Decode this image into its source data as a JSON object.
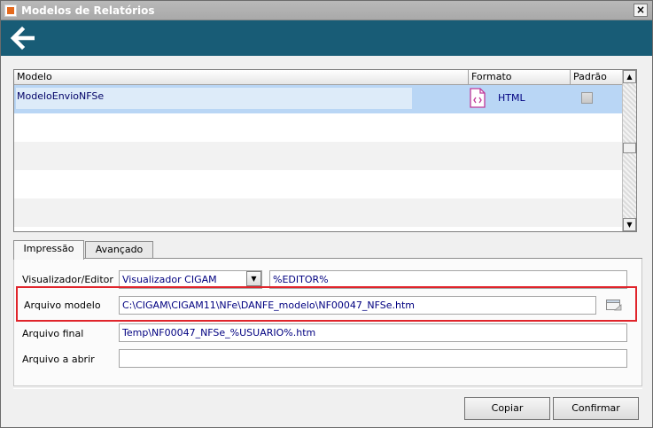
{
  "window": {
    "title": "Modelos de Relatórios",
    "close_glyph": "×",
    "icon": "app-icon"
  },
  "toolbar": {
    "back_icon": "back-arrow-icon"
  },
  "grid": {
    "columns": [
      "Modelo",
      "Formato",
      "Padrão"
    ],
    "rows": [
      {
        "modelo": "ModeloEnvioNFSe",
        "formato": "HTML",
        "padrao": false,
        "format_icon": "html-file-icon"
      }
    ]
  },
  "tabs": [
    {
      "label": "Impressão",
      "active": true
    },
    {
      "label": "Avançado",
      "active": false
    }
  ],
  "form": {
    "visualizador_label": "Visualizador/Editor",
    "visualizador_value": "Visualizador CIGAM",
    "editor_value": "%EDITOR%",
    "arquivo_modelo_label": "Arquivo modelo",
    "arquivo_modelo_value": "C:\\CIGAM\\CIGAM11\\NFe\\DANFE_modelo\\NF00047_NFSe.htm",
    "arquivo_final_label": "Arquivo final",
    "arquivo_final_value": "Temp\\NF00047_NFSe_%USUARIO%.htm",
    "arquivo_abrir_label": "Arquivo a abrir",
    "arquivo_abrir_value": ""
  },
  "buttons": {
    "copiar": "Copiar",
    "confirmar": "Confirmar"
  },
  "colors": {
    "toolbar": "#185c76",
    "selection": "#b9d6f5",
    "highlight": "#e0242b",
    "format_icon": "#c0399a"
  }
}
